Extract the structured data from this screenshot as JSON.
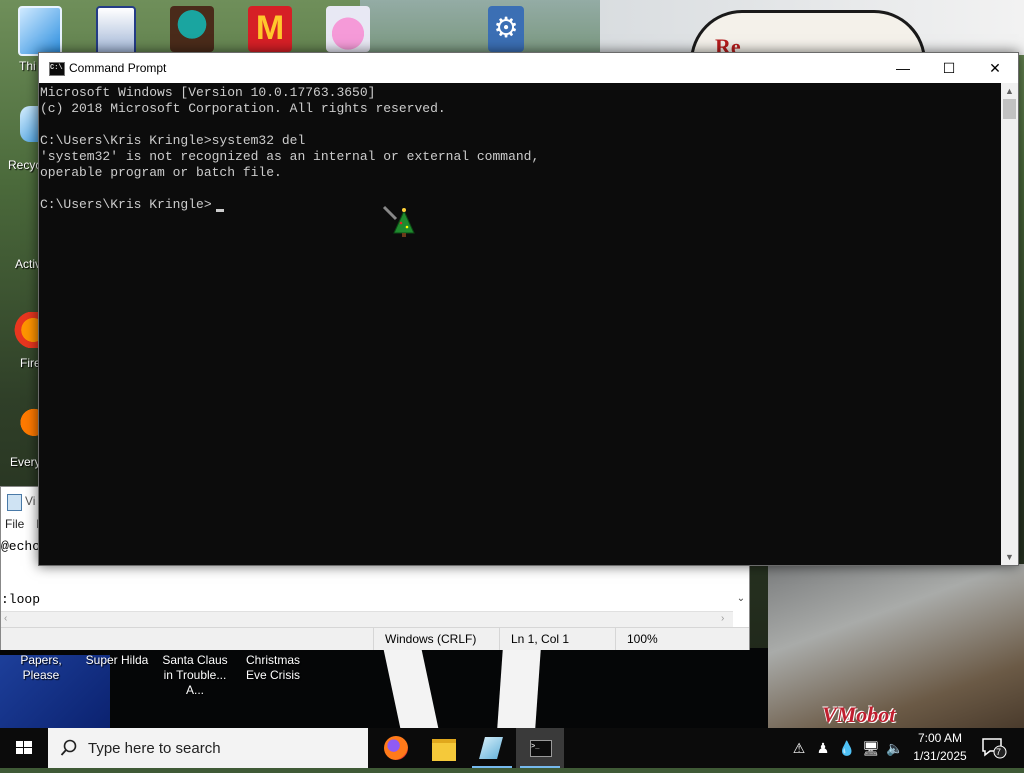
{
  "desktop": {
    "left_labels": [
      "Thi",
      "Recyc",
      "Activ",
      "Fire",
      "Every"
    ],
    "bottom_labels": [
      "Papers, Please",
      "Super Hilda",
      "Santa Claus in Trouble... A...",
      "Christmas Eve Crisis"
    ],
    "sign_text": "Re",
    "logo_text": "VMobot"
  },
  "notepad": {
    "title": "Vi",
    "menu": [
      "File",
      "E"
    ],
    "lines": [
      "@echo",
      ":loop"
    ],
    "status": {
      "line_ending": "Windows (CRLF)",
      "position": "Ln 1, Col 1",
      "zoom": "100%"
    }
  },
  "cmd": {
    "title": "Command Prompt",
    "lines": [
      "Microsoft Windows [Version 10.0.17763.3650]",
      "(c) 2018 Microsoft Corporation. All rights reserved.",
      "",
      "C:\\Users\\Kris Kringle>system32 del",
      "'system32' is not recognized as an internal or external command,",
      "operable program or batch file.",
      "",
      "C:\\Users\\Kris Kringle>"
    ],
    "minimize_glyph": "—",
    "maximize_glyph": "☐",
    "close_glyph": "✕"
  },
  "taskbar": {
    "search_placeholder": "Type here to search",
    "apps": [
      "firefox-icon",
      "file-explorer-icon",
      "notepad-icon",
      "command-prompt-icon"
    ],
    "clock_time": "7:00 AM",
    "clock_date": "1/31/2025",
    "notification_count": "7"
  },
  "colors": {
    "terminal_bg": "#0c0c0c",
    "terminal_fg": "#cccccc",
    "taskbar_bg": "#0b0b0b",
    "accent": "#76b9ed"
  }
}
